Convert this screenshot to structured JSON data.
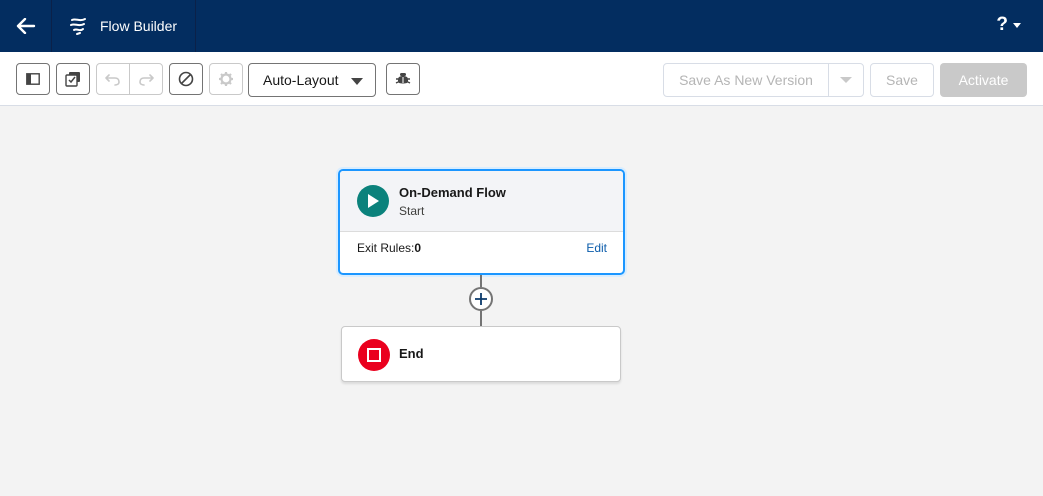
{
  "header": {
    "app_title": "Flow Builder",
    "help_label": "?"
  },
  "toolbar": {
    "layout_mode": "Auto-Layout",
    "save_as_new_version": "Save As New Version",
    "save": "Save",
    "activate": "Activate"
  },
  "canvas": {
    "start": {
      "title": "On-Demand Flow",
      "subtitle": "Start",
      "exit_rules_label": "Exit Rules:",
      "exit_rules_value": "0",
      "edit_label": "Edit"
    },
    "end": {
      "title": "End"
    }
  },
  "colors": {
    "header_bg": "#032d60",
    "start_icon": "#0b827c",
    "end_icon": "#ea001e",
    "selection": "#1b96ff",
    "link": "#0b5cab"
  }
}
